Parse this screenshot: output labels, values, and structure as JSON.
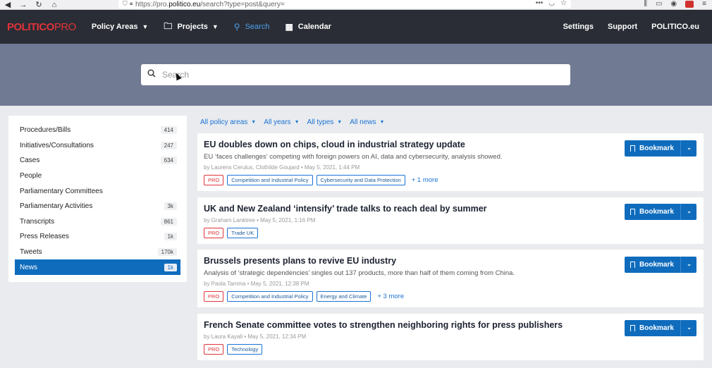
{
  "browser": {
    "url_prefix": "https://pro.",
    "url_domain": "politico.eu",
    "url_suffix": "/search?type=post&query="
  },
  "app": {
    "logo_main": "POLITICO",
    "logo_suffix": "PRO",
    "nav": {
      "policy_areas": "Policy Areas",
      "projects": "Projects",
      "search": "Search",
      "calendar": "Calendar",
      "settings": "Settings",
      "support": "Support",
      "politico_eu": "POLITICO.eu"
    },
    "accent_color": "#0f6cbd",
    "brand_color": "#e0333a"
  },
  "search": {
    "placeholder": "Search",
    "value": ""
  },
  "sidebar": {
    "items": [
      {
        "label": "Procedures/Bills",
        "count": "414"
      },
      {
        "label": "Initiatives/Consultations",
        "count": "247"
      },
      {
        "label": "Cases",
        "count": "634"
      },
      {
        "label": "People",
        "count": ""
      },
      {
        "label": "Parliamentary Committees",
        "count": ""
      },
      {
        "label": "Parliamentary Activities",
        "count": "3k"
      },
      {
        "label": "Transcripts",
        "count": "861"
      },
      {
        "label": "Press Releases",
        "count": "1k"
      },
      {
        "label": "Tweets",
        "count": "170k"
      },
      {
        "label": "News",
        "count": "1k",
        "active": true
      }
    ]
  },
  "filters": {
    "policy_areas": "All policy areas",
    "years": "All years",
    "types": "All types",
    "news": "All news"
  },
  "bookmark_label": "Bookmark",
  "results": [
    {
      "title": "EU doubles down on chips, cloud in industrial strategy update",
      "summary": "EU ‘faces challenges’ competing with foreign powers on AI, data and cybersecurity, analysis showed.",
      "byline": "by Laurens Cerulus, Clothilde Goujard  •  May 5, 2021, 1:44 PM",
      "tags": [
        "PRO",
        "Competition and Industrial Policy",
        "Cybersecurity and Data Protection"
      ],
      "more": "+ 1 more"
    },
    {
      "title": "UK and New Zealand ‘intensify’ trade talks to reach deal by summer",
      "summary": "",
      "byline": "by Graham Lanktree  •  May 5, 2021, 1:16 PM",
      "tags": [
        "PRO",
        "Trade UK"
      ],
      "more": ""
    },
    {
      "title": "Brussels presents plans to revive EU industry",
      "summary": "Analysis of ‘strategic dependencies’ singles out 137 products, more than half of them coming from China.",
      "byline": "by Paola Tamma  •  May 5, 2021, 12:38 PM",
      "tags": [
        "PRO",
        "Competition and Industrial Policy",
        "Energy and Climate"
      ],
      "more": "+ 3 more"
    },
    {
      "title": "French Senate committee votes to strengthen neighboring rights for press publishers",
      "summary": "",
      "byline": "by Laura Kayali  •  May 5, 2021, 12:34 PM",
      "tags": [
        "PRO",
        "Technology"
      ],
      "more": ""
    }
  ]
}
